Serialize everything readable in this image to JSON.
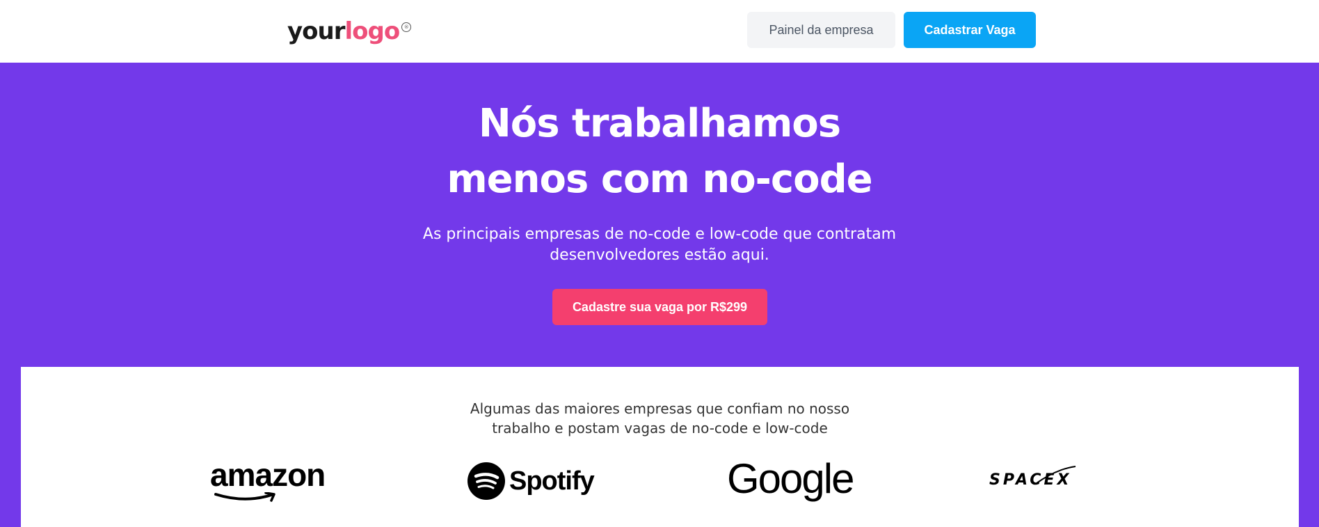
{
  "header": {
    "logo_primary": "your",
    "logo_accent": "logo",
    "logo_mark": "®",
    "panel_button": "Painel da empresa",
    "post_job_button": "Cadastrar Vaga"
  },
  "hero": {
    "title_line1": "Nós trabalhamos",
    "title_line2": "menos com no-code",
    "subtitle_line1": "As principais empresas de no-code e low-code que contratam",
    "subtitle_line2": "desenvolvedores estão aqui.",
    "cta_button": "Cadastre sua vaga por R$299"
  },
  "companies": {
    "text_line1": "Algumas das maiores empresas que confiam no nosso",
    "text_line2": "trabalho e postam vagas de no-code e low-code",
    "logos": [
      {
        "name": "amazon"
      },
      {
        "name": "Spotify"
      },
      {
        "name": "Google"
      },
      {
        "name": "SPACEX"
      }
    ]
  },
  "colors": {
    "hero_bg": "#7339ea",
    "post_job_button": "#0aa5f5",
    "cta_button": "#f43f6e",
    "logo_accent": "#ee4f7a"
  }
}
